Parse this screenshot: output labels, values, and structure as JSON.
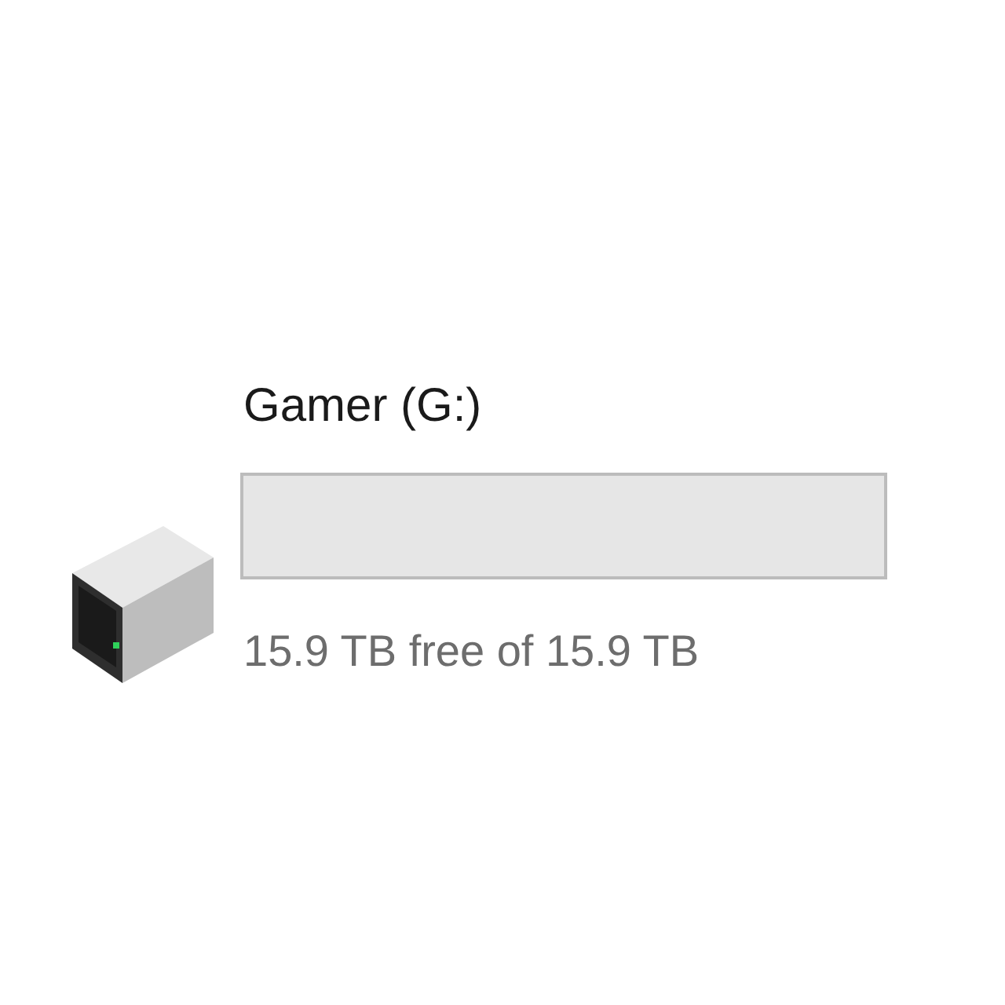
{
  "drive": {
    "name": "Gamer (G:)",
    "level": 0,
    "free_text": "15.9 TB free of 15.9 TB"
  }
}
